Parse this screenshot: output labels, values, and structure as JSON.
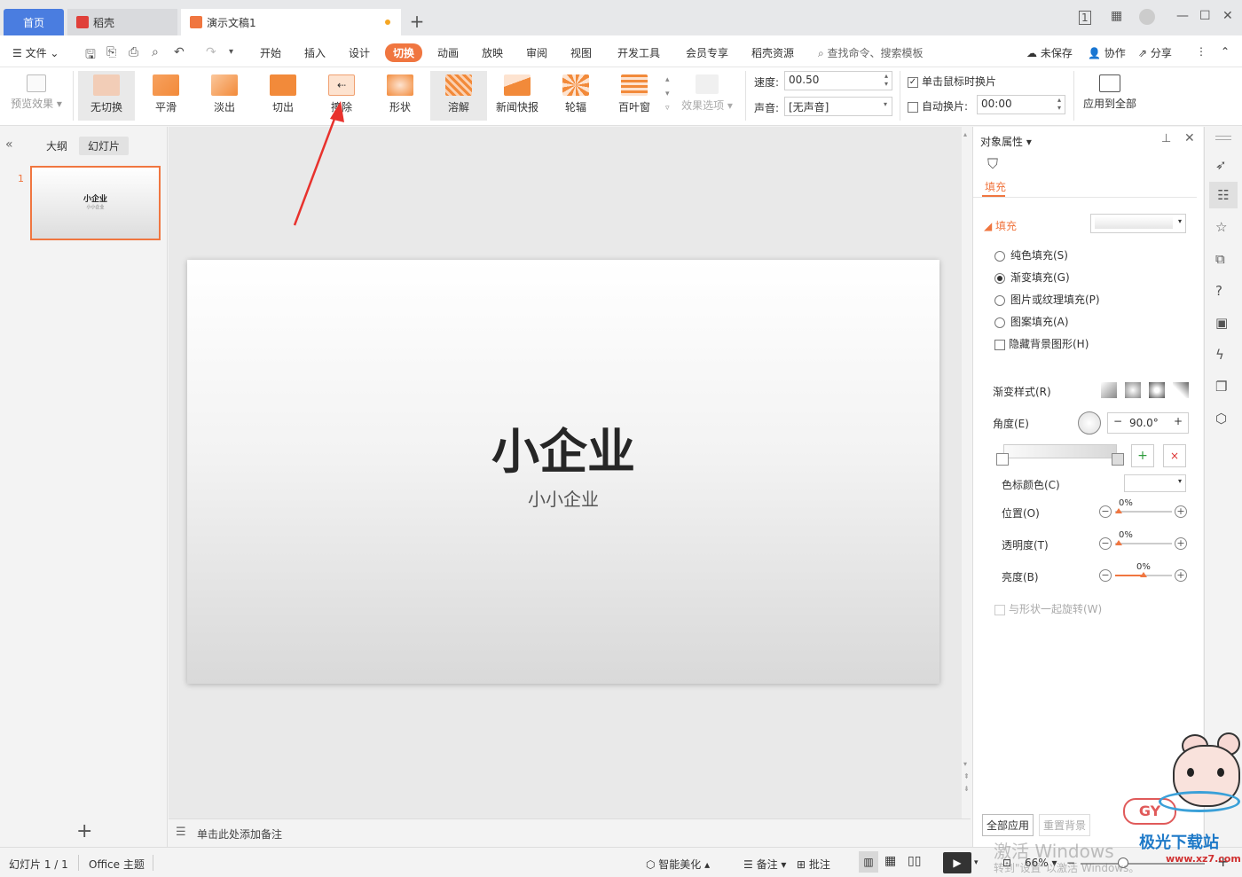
{
  "tabs": {
    "home": "首页",
    "daoke": "稻壳",
    "doc": "演示文稿1"
  },
  "menu": {
    "file": "文件",
    "items": [
      "开始",
      "插入",
      "设计",
      "切换",
      "动画",
      "放映",
      "审阅",
      "视图",
      "开发工具",
      "会员专享",
      "稻壳资源"
    ],
    "search": "查找命令、搜索模板",
    "unsaved": "未保存",
    "collab": "协作",
    "share": "分享"
  },
  "ribbon": {
    "preview": "预览效果",
    "transitions": [
      "无切换",
      "平滑",
      "淡出",
      "切出",
      "擦除",
      "形状",
      "溶解",
      "新闻快报",
      "轮辐",
      "百叶窗"
    ],
    "effect_options": "效果选项",
    "speed_label": "速度:",
    "speed_value": "00.50",
    "sound_label": "声音:",
    "sound_value": "[无声音]",
    "on_click": "单击鼠标时换片",
    "auto": "自动换片:",
    "auto_value": "00:00",
    "apply_all": "应用到全部"
  },
  "left": {
    "outline": "大纲",
    "slides": "幻灯片",
    "slide_num": "1"
  },
  "slide": {
    "title": "小企业",
    "subtitle": "小小企业"
  },
  "notes": "单击此处添加备注",
  "panel": {
    "header": "对象属性",
    "tab": "填充",
    "section": "填充",
    "options": [
      "纯色填充(S)",
      "渐变填充(G)",
      "图片或纹理填充(P)",
      "图案填充(A)"
    ],
    "hide_bg": "隐藏背景图形(H)",
    "gradient_style": "渐变样式(R)",
    "angle": "角度(E)",
    "angle_value": "90.0°",
    "stop_color": "色标颜色(C)",
    "position": "位置(O)",
    "transparency": "透明度(T)",
    "brightness": "亮度(B)",
    "pct": "0%",
    "rotate_with_shape": "与形状一起旋转(W)",
    "apply_all": "全部应用",
    "reset_bg": "重置背景"
  },
  "status": {
    "slide_info": "幻灯片 1 / 1",
    "theme": "Office 主题",
    "beautify": "智能美化",
    "notes": "备注",
    "comments": "批注",
    "zoom": "66%"
  },
  "watermark": {
    "activate": "激活 Windows",
    "activate_sub": "转到\"设置\"以激活 Windows。",
    "logo": "极光下载站",
    "url": "www.xz7.com"
  },
  "colors": {
    "accent": "#f07640",
    "tab_blue": "#4a7de0",
    "arrow": "#e8322d"
  }
}
